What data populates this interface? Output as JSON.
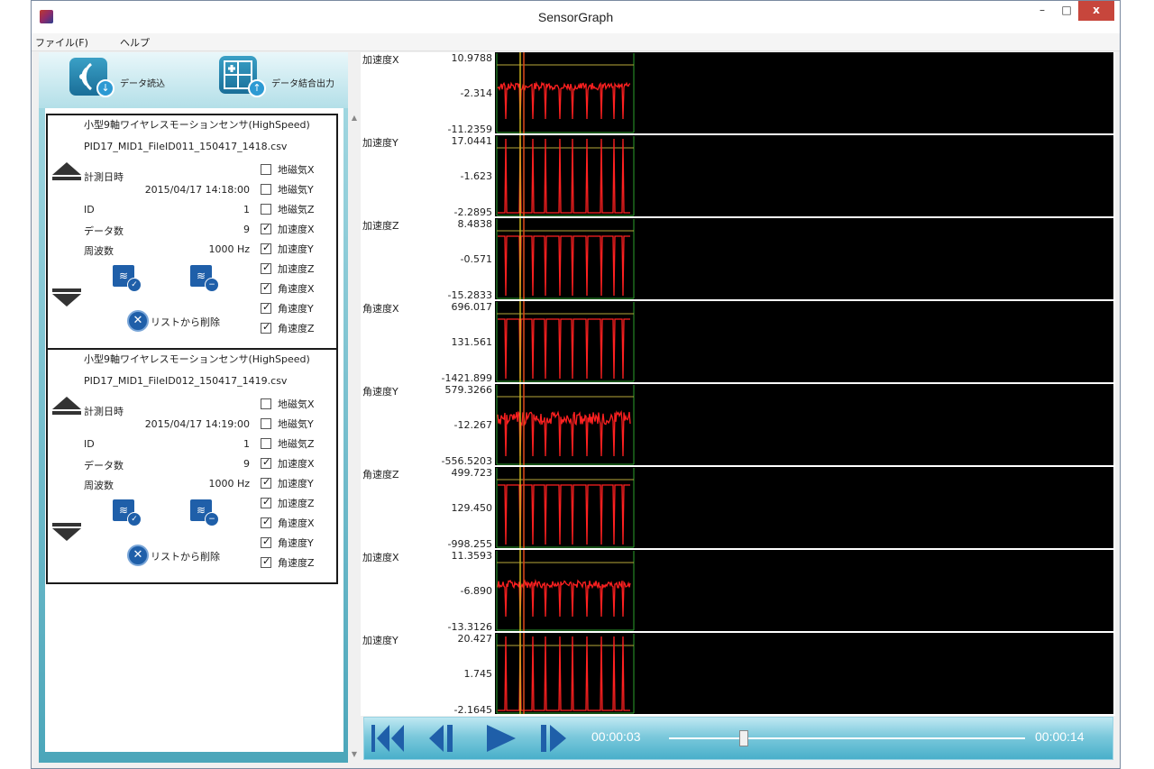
{
  "window": {
    "title": "SensorGraph",
    "min_label": "–",
    "max_label": "□",
    "close_label": "x"
  },
  "menu": {
    "file": "ファイル(F)",
    "help": "ヘルプ"
  },
  "actions": {
    "load_label": "データ読込",
    "merge_label": "データ結合出力"
  },
  "sensors": [
    {
      "title": "小型9軸ワイヤレスモーションセンサ(HighSpeed)",
      "file": "PID17_MID1_FileID011_150417_1418.csv",
      "labels": {
        "date": "計測日時",
        "id": "ID",
        "count": "データ数",
        "freq": "周波数"
      },
      "date": "2015/04/17 14:18:00",
      "id": "1",
      "count": "9",
      "freq": "1000 Hz",
      "checkboxes": [
        {
          "label": "地磁気X",
          "checked": false
        },
        {
          "label": "地磁気Y",
          "checked": false
        },
        {
          "label": "地磁気Z",
          "checked": false
        },
        {
          "label": "加速度X",
          "checked": true
        },
        {
          "label": "加速度Y",
          "checked": true
        },
        {
          "label": "加速度Z",
          "checked": true
        },
        {
          "label": "角速度X",
          "checked": true
        },
        {
          "label": "角速度Y",
          "checked": true
        },
        {
          "label": "角速度Z",
          "checked": true
        }
      ],
      "remove_label": "リストから削除"
    },
    {
      "title": "小型9軸ワイヤレスモーションセンサ(HighSpeed)",
      "file": "PID17_MID1_FileID012_150417_1419.csv",
      "labels": {
        "date": "計測日時",
        "id": "ID",
        "count": "データ数",
        "freq": "周波数"
      },
      "date": "2015/04/17 14:19:00",
      "id": "1",
      "count": "9",
      "freq": "1000 Hz",
      "checkboxes": [
        {
          "label": "地磁気X",
          "checked": false
        },
        {
          "label": "地磁気Y",
          "checked": false
        },
        {
          "label": "地磁気Z",
          "checked": false
        },
        {
          "label": "加速度X",
          "checked": true
        },
        {
          "label": "加速度Y",
          "checked": true
        },
        {
          "label": "加速度Z",
          "checked": true
        },
        {
          "label": "角速度X",
          "checked": true
        },
        {
          "label": "角速度Y",
          "checked": true
        },
        {
          "label": "角速度Z",
          "checked": true
        }
      ],
      "remove_label": "リストから削除"
    }
  ],
  "graphs": [
    {
      "name": "加速度X",
      "ymax": "10.9788",
      "ymid": "-2.314",
      "ymin": "-11.2359",
      "style": "noisy-down",
      "color": "#ff2020"
    },
    {
      "name": "加速度Y",
      "ymax": "17.0441",
      "ymid": "-1.623",
      "ymin": "-2.2895",
      "style": "spikes-up",
      "color": "#ff2020"
    },
    {
      "name": "加速度Z",
      "ymax": "8.4838",
      "ymid": "-0.571",
      "ymin": "-15.2833",
      "style": "spikes-down",
      "color": "#ff2020"
    },
    {
      "name": "角速度X",
      "ymax": "696.017",
      "ymid": "131.561",
      "ymin": "-1421.899",
      "style": "spikes-down",
      "color": "#ff2020"
    },
    {
      "name": "角速度Y",
      "ymax": "579.3266",
      "ymid": "-12.267",
      "ymin": "-556.5203",
      "style": "dense",
      "color": "#ff2020"
    },
    {
      "name": "角速度Z",
      "ymax": "499.723",
      "ymid": "129.450",
      "ymin": "-998.255",
      "style": "spikes-down",
      "color": "#ff2020"
    },
    {
      "name": "加速度X",
      "ymax": "11.3593",
      "ymid": "-6.890",
      "ymin": "-13.3126",
      "style": "noisy-down",
      "color": "#ff2020"
    },
    {
      "name": "加速度Y",
      "ymax": "20.427",
      "ymid": "1.745",
      "ymin": "-2.1645",
      "style": "spikes-up",
      "color": "#ff2020"
    }
  ],
  "player": {
    "current_time": "00:00:03",
    "total_time": "00:00:14",
    "progress": 0.21
  }
}
